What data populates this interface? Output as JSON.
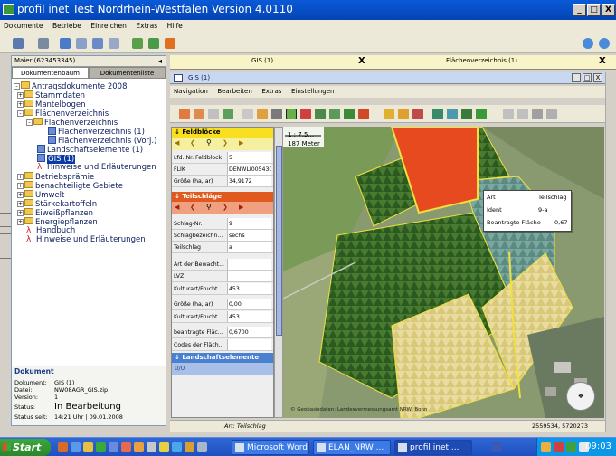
{
  "window": {
    "title": "profil inet Test Nordrhein-Westfalen Version 4.0110",
    "controls": [
      "_",
      "□",
      "X"
    ]
  },
  "menubar": {
    "items": [
      "Dokumente",
      "Betriebe",
      "Einreichen",
      "Extras",
      "Hilfe"
    ]
  },
  "left_panel": {
    "node_title": "Maier (623453345)",
    "tabs": [
      "Dokumentenbaum",
      "Dokumentenliste"
    ],
    "tree": [
      {
        "label": "Antragsdokumente 2008",
        "icon": "folder-icon"
      },
      {
        "label": "Stammdaten",
        "icon": "folder-icon"
      },
      {
        "label": "Mantelbogen",
        "icon": "folder-icon"
      },
      {
        "label": "Flächenverzeichnis",
        "icon": "folder-icon"
      },
      {
        "label": "Flächenverzeichnis",
        "icon": "folder-icon"
      },
      {
        "label": "Flächenverzeichnis (1)",
        "icon": "document-icon"
      },
      {
        "label": "Flächenverzeichnis (Vorj.)",
        "icon": "document-icon"
      },
      {
        "label": "Landschaftselemente (1)",
        "icon": "document-icon"
      },
      {
        "label": "GIS (1)",
        "icon": "document-icon"
      },
      {
        "label": "Hinweise und Erläuterungen",
        "icon": "pdf-icon"
      },
      {
        "label": "Betriebsprämie",
        "icon": "folder-icon"
      },
      {
        "label": "benachteiligte Gebiete",
        "icon": "folder-icon"
      },
      {
        "label": "Umwelt",
        "icon": "folder-icon"
      },
      {
        "label": "Stärkekartoffeln",
        "icon": "folder-icon"
      },
      {
        "label": "Eiweißpflanzen",
        "icon": "folder-icon"
      },
      {
        "label": "Energiepflanzen",
        "icon": "folder-icon"
      },
      {
        "label": "Handbuch",
        "icon": "pdf-icon"
      },
      {
        "label": "Hinweise und Erläuterungen",
        "icon": "pdf-icon"
      }
    ],
    "document": {
      "heading": "Dokument",
      "rows": [
        {
          "key": "Dokument:",
          "value": "GIS (1)"
        },
        {
          "key": "Datei:",
          "value": "NW08AGR_GIS.zip"
        },
        {
          "key": "Version:",
          "value": "1"
        },
        {
          "key": "Status:",
          "value": "In Bearbeitung"
        },
        {
          "key": "Status seit:",
          "value": "14:21 Uhr | 09.01.2008"
        }
      ]
    }
  },
  "main_tabs": [
    {
      "label": "GIS (1)",
      "close": "X"
    },
    {
      "label": "Flächenverzeichnis (1)",
      "close": "X"
    }
  ],
  "inner_window": {
    "title": "GIS (1)",
    "controls": [
      "_",
      "□",
      "X"
    ],
    "menu": [
      "Navigation",
      "Bearbeiten",
      "Extras",
      "Einstellungen"
    ]
  },
  "props": {
    "section1": "Feldblöcke",
    "section1_rows": [
      {
        "key": "Lfd. Nr. Feldblock",
        "value": "5"
      },
      {
        "key": "FLIK",
        "value": "DENWLI0054305..."
      },
      {
        "key": "Größe (ha, ar)",
        "value": "34,9172"
      }
    ],
    "section2": "Teilschläge",
    "section2_rows": [
      {
        "key": "Schlag-Nr.",
        "value": "9"
      },
      {
        "key": "Schlagbezeichn...",
        "value": "sechs"
      },
      {
        "key": "Teilschlag",
        "value": "a"
      },
      {
        "key": "Art der Bewacht...",
        "value": ""
      },
      {
        "key": "LVZ",
        "value": ""
      },
      {
        "key": "Kulturart/Frucht...",
        "value": "453"
      },
      {
        "key": "Größe (ha, ar)",
        "value": "0,00"
      },
      {
        "key": "Kulturart/Frucht...",
        "value": "453"
      },
      {
        "key": "beantragte Fläc...",
        "value": "0,6700"
      },
      {
        "key": "Codes der Fläch...",
        "value": ""
      }
    ],
    "section3": "Landschaftselemente",
    "section3_value": "0/0"
  },
  "map": {
    "scale": "1 : 7.5...",
    "scale_distance": "187 Meter",
    "info": [
      {
        "key": "Art",
        "value": "Teilschlag"
      },
      {
        "key": "Ident",
        "value": "9-a"
      },
      {
        "key": "Beantragte Fläche",
        "value": "0,67"
      }
    ],
    "copyright": "© Geobasisdaten: Landesvermessungsamt NRW, Bonn",
    "colors": {
      "selected": "#e84a20",
      "pattern": "#2a6a2a",
      "yellow_outline": "#f0d030"
    }
  },
  "statusbar": {
    "layer": "Art: Teilschlag",
    "coords": "2559534, 5720273"
  },
  "taskbar": {
    "start": "Start",
    "tasks": [
      {
        "label": "Microsoft Word",
        "active": false
      },
      {
        "label": "ELAN_NRW ...",
        "active": false
      },
      {
        "label": "profil inet ...",
        "active": true
      }
    ],
    "clock": "09:03"
  }
}
